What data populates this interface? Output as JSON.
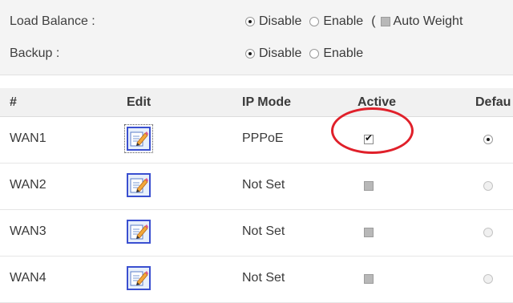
{
  "settings": {
    "load_balance": {
      "label": "Load Balance :",
      "options": [
        "Disable",
        "Enable"
      ],
      "selected": "Disable",
      "paren": "(",
      "auto_weight_label": "Auto Weight"
    },
    "backup": {
      "label": "Backup :",
      "options": [
        "Disable",
        "Enable"
      ],
      "selected": "Disable"
    }
  },
  "table": {
    "headers": {
      "num": "#",
      "edit": "Edit",
      "ip_mode": "IP Mode",
      "active": "Active",
      "default": "Defau"
    },
    "rows": [
      {
        "name": "WAN1",
        "ip_mode": "PPPoE",
        "active": true,
        "default": true
      },
      {
        "name": "WAN2",
        "ip_mode": "Not Set",
        "active": false,
        "default": false
      },
      {
        "name": "WAN3",
        "ip_mode": "Not Set",
        "active": false,
        "default": false
      },
      {
        "name": "WAN4",
        "ip_mode": "Not Set",
        "active": false,
        "default": false
      }
    ],
    "edit_icon": "edit-document-icon"
  },
  "annotation": {
    "highlight_color": "#e0202a"
  }
}
